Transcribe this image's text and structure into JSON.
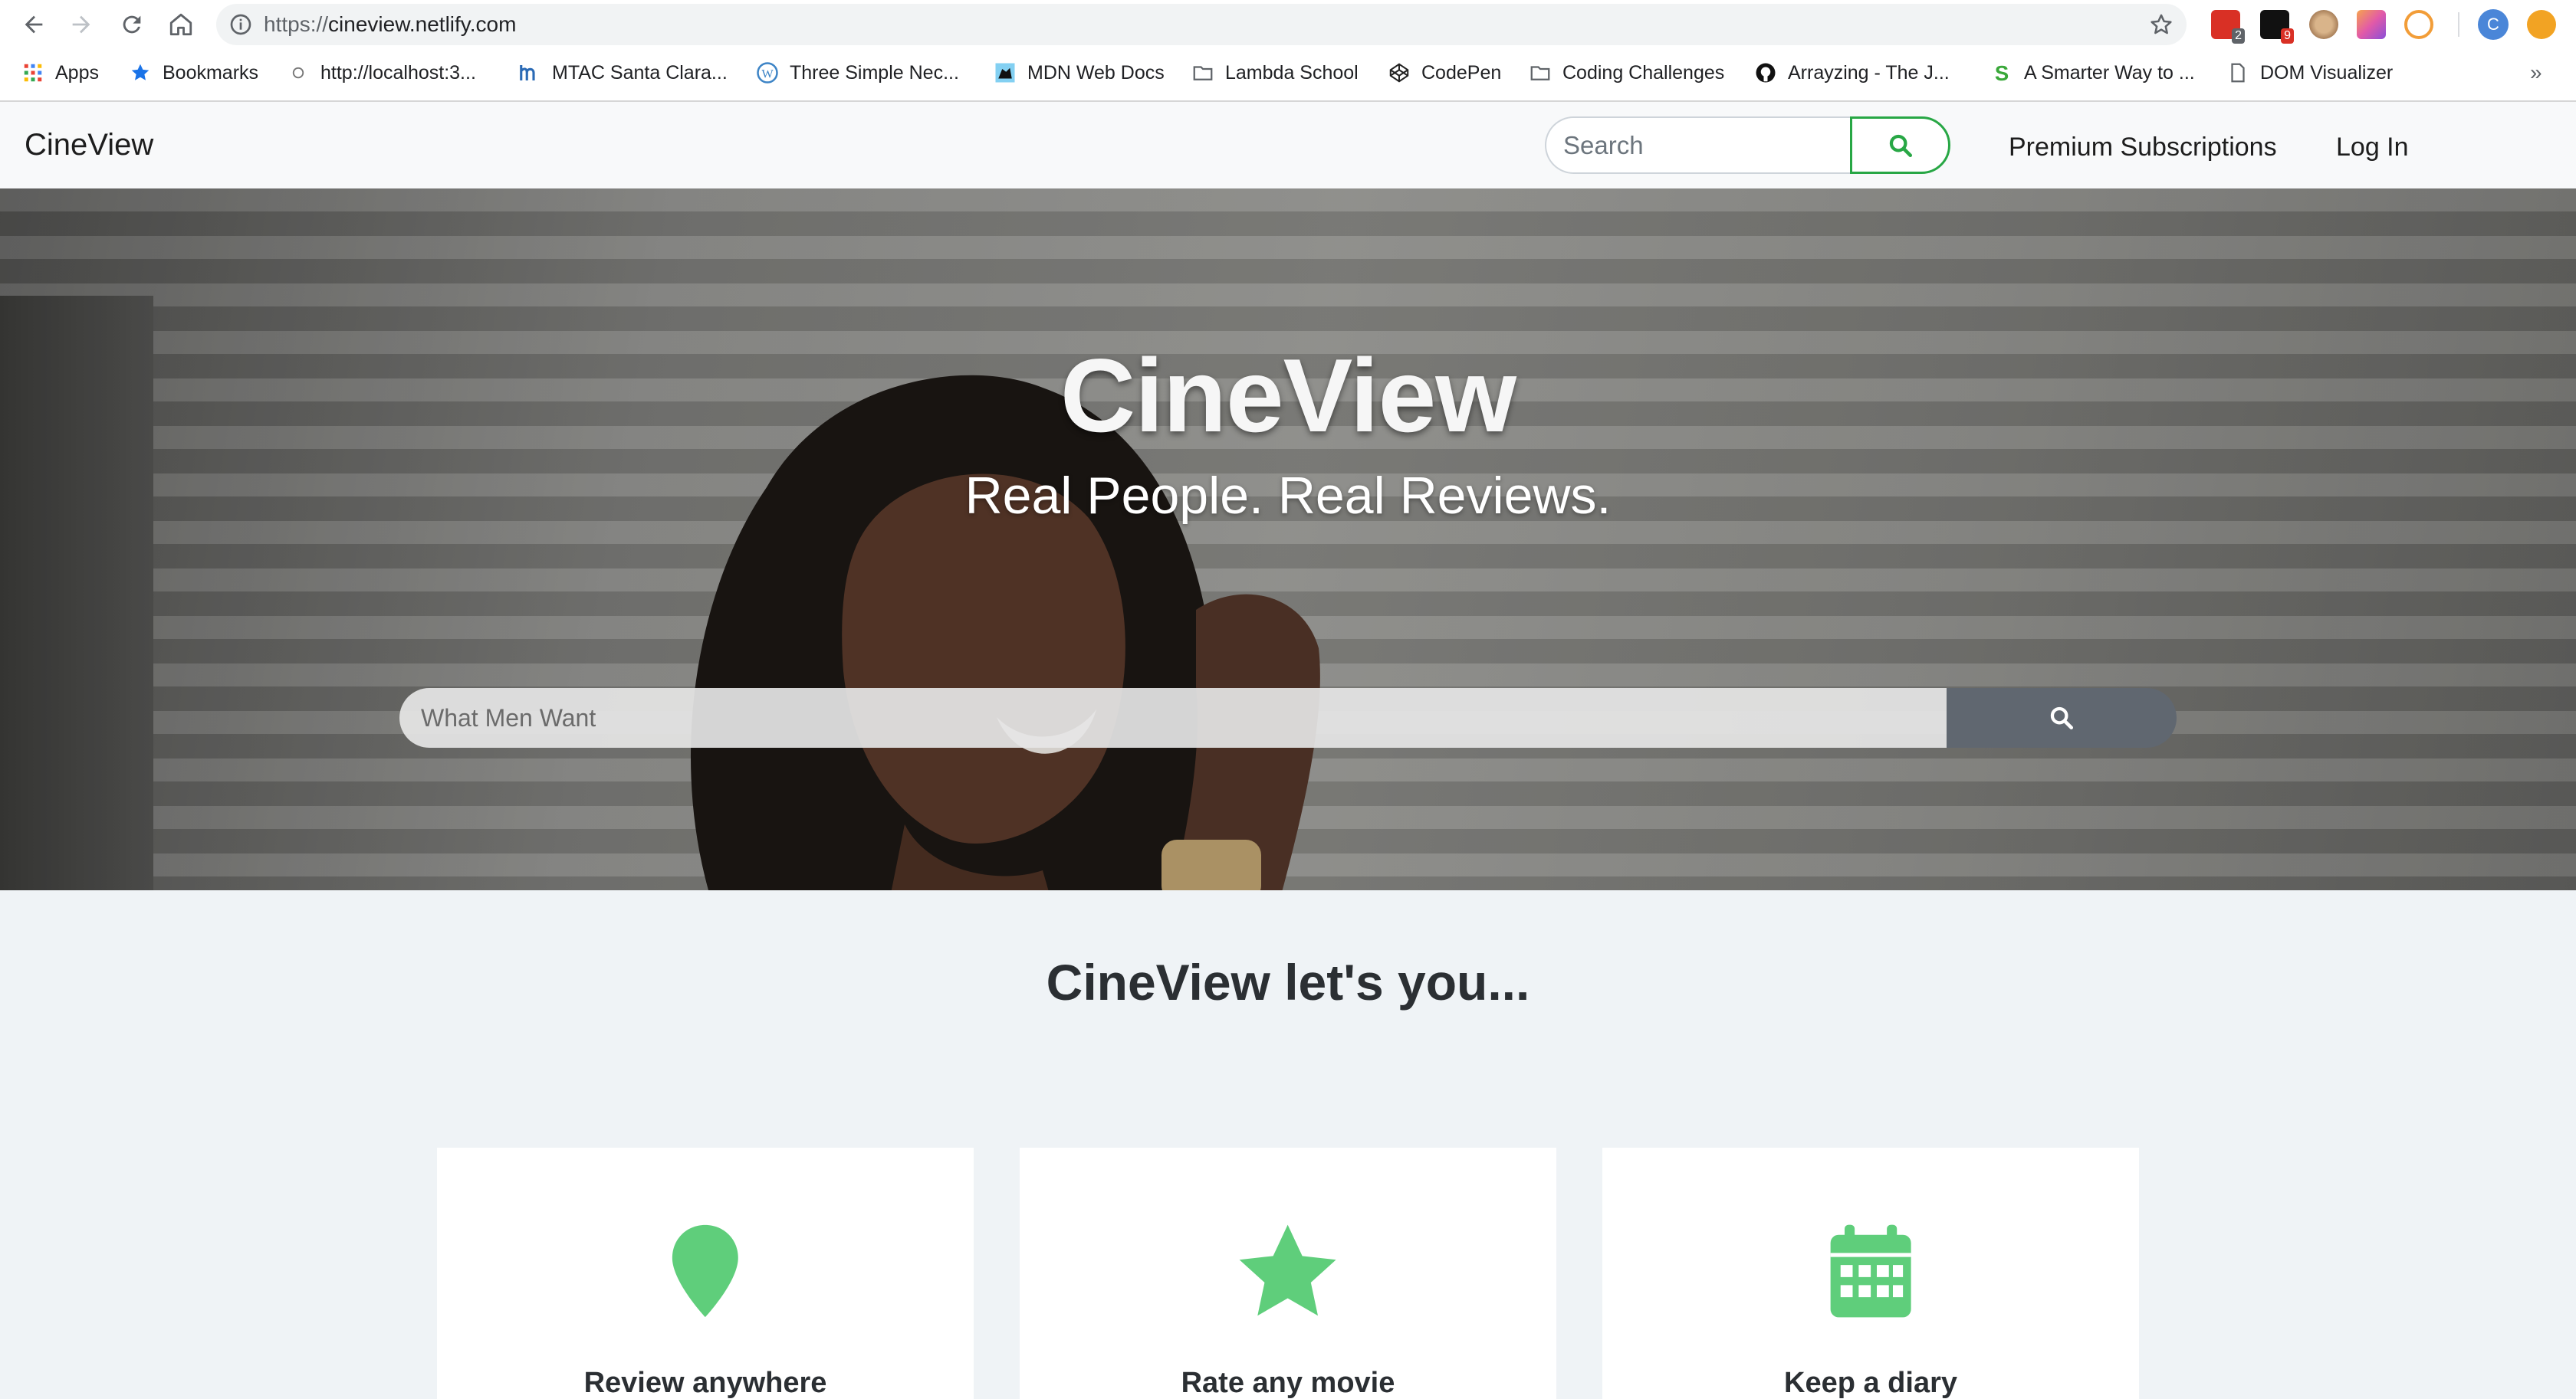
{
  "browser": {
    "url_scheme": "https://",
    "url_host": "cineview.netlify.com",
    "profile_initial": "C",
    "extensions": [
      {
        "name": "ext-todoist-icon",
        "badge": "2",
        "color": "#d93025"
      },
      {
        "name": "ext-amazon-icon",
        "badge": "9",
        "color": "#111111"
      },
      {
        "name": "ext-cookie-icon",
        "badge": "",
        "color": "#c8a37a"
      },
      {
        "name": "ext-gradient-icon",
        "badge": "",
        "color": "#e25aa8"
      },
      {
        "name": "ext-swirl-icon",
        "badge": "",
        "color": "#f29d38"
      },
      {
        "name": "ext-honey-icon",
        "badge": "",
        "color": "#f2a323"
      }
    ],
    "bookmarks": {
      "apps": "Apps",
      "bookmarks": "Bookmarks",
      "localhost": "http://localhost:3...",
      "mtac": "MTAC Santa Clara...",
      "three_simple": "Three Simple Nec...",
      "mdn": "MDN Web Docs",
      "lambda": "Lambda School",
      "codepen": "CodePen",
      "coding": "Coding Challenges",
      "arrayzing": "Arrayzing - The J...",
      "smarter": "A Smarter Way to ...",
      "dom": "DOM Visualizer",
      "more": "»"
    }
  },
  "header": {
    "brand": "CineView",
    "search_placeholder": "Search",
    "premium_link": "Premium Subscriptions",
    "login_link": "Log In"
  },
  "hero": {
    "title": "CineView",
    "subtitle": "Real People. Real Reviews.",
    "search_placeholder": "What Men Want"
  },
  "features": {
    "title": "CineView let's you...",
    "cards": [
      {
        "title": "Review anywhere",
        "icon": "map-marker-icon"
      },
      {
        "title": "Rate any movie",
        "icon": "star-icon"
      },
      {
        "title": "Keep a diary",
        "icon": "calendar-icon"
      }
    ]
  },
  "colors": {
    "accent_green": "#28a745",
    "icon_green": "#5fce7b",
    "hero_button": "#606770",
    "page_bg": "#eff3f6"
  }
}
